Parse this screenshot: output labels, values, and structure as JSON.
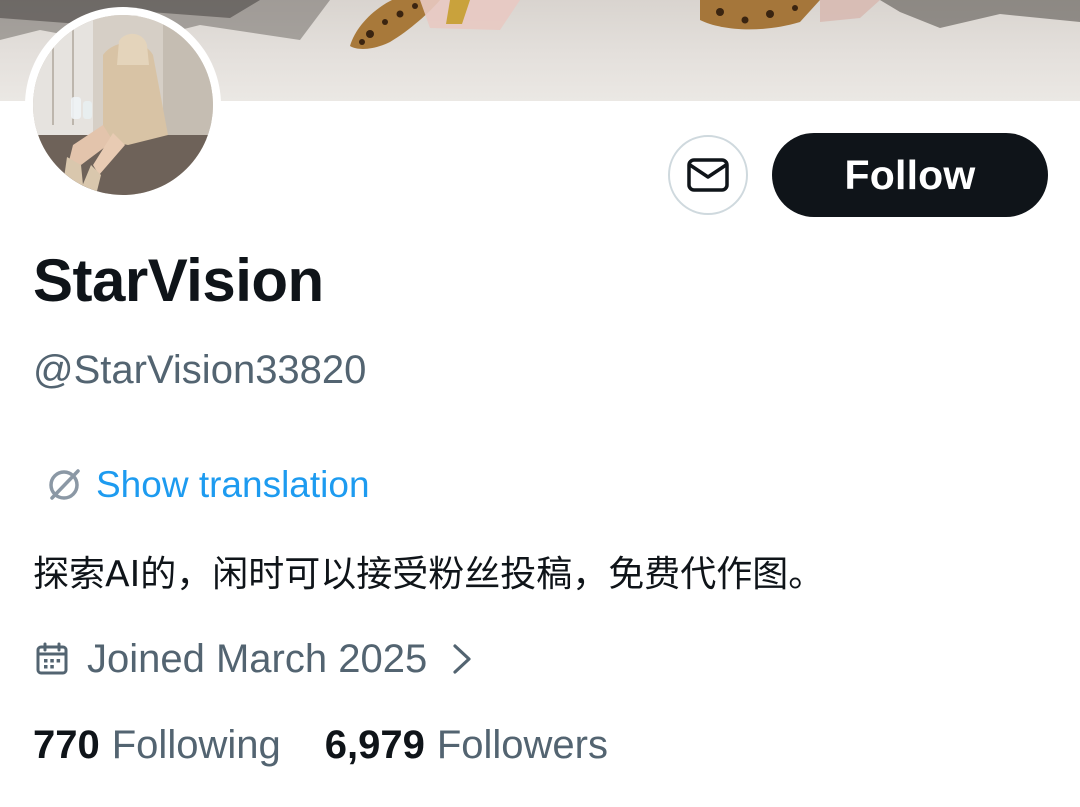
{
  "profile": {
    "display_name": "StarVision",
    "handle": "@StarVision33820",
    "bio": "探索AI的，闲时可以接受粉丝投稿，免费代作图。",
    "joined": "Joined March 2025"
  },
  "actions": {
    "follow_label": "Follow",
    "message_icon": "mail-icon"
  },
  "translation": {
    "label": "Show translation",
    "icon": "translate-icon"
  },
  "stats": {
    "following_count": "770",
    "following_label": "Following",
    "followers_count": "6,979",
    "followers_label": "Followers"
  },
  "colors": {
    "text_primary": "#0f1419",
    "text_secondary": "#536471",
    "link": "#1d9bf0",
    "follow_bg": "#0f1419",
    "border": "#cfd9de"
  }
}
